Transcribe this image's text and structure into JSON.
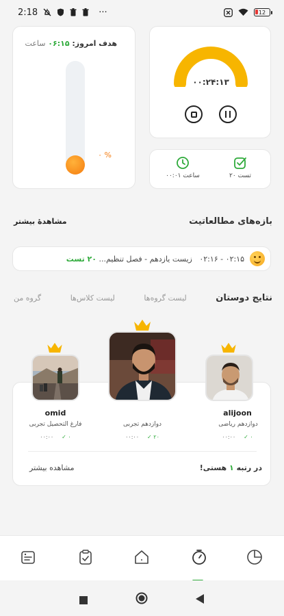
{
  "status_bar": {
    "time": "2:18",
    "more": "···",
    "battery": "12",
    "icons": [
      "mute-icon",
      "shield-icon",
      "trash-icon",
      "trash-icon",
      "dnd-icon",
      "wifi-icon",
      "battery-icon"
    ]
  },
  "goal": {
    "title": "هدف امروز:",
    "time": "۰۶:۱۵",
    "unit": "ساعت",
    "percent_label": "% ۰",
    "progress": 0
  },
  "timer": {
    "display": "۰۰:۲۴:۱۳",
    "gauge_fraction": 0.62,
    "gauge_color": "#f7b500"
  },
  "stats": {
    "tests": "۲۰ تست",
    "hours": "۰۰:۰۱ ساعت"
  },
  "sessions": {
    "title": "بازه‌های مطالعاتیت",
    "see_more": "مشاهدهٔ بیشتر",
    "entry_time": "۰۲:۱۵ - ۰۲:۱۶",
    "entry_subject": "زیست یازدهم - فصل تنظیم...",
    "entry_tests": "۲۰ تست"
  },
  "tabs": [
    "نتایج دوستان",
    "لیست گروه‌ها",
    "لیست کلاس‌ها",
    "گروه من"
  ],
  "friends": {
    "people": [
      {
        "name": "alijoon",
        "grade": "دوازدهم ریاضی",
        "tests": "۰",
        "time": "۰۰:۰۰"
      },
      {
        "name": "",
        "grade": "دوازدهم تجربی",
        "tests": "۲۰",
        "time": "۰۰:۰۰"
      },
      {
        "name": "omid",
        "grade": "فارغ التحصیل تجربی",
        "tests": "۰",
        "time": "۰۰:۰۰"
      }
    ],
    "rank_prefix": "در رتبه",
    "rank_num": "۱",
    "rank_suffix": "هستی!",
    "see_more": "مشاهده بیشتر"
  },
  "bottom_nav": [
    "report-icon",
    "timer-icon",
    "home-icon",
    "clipboard-icon",
    "notes-icon"
  ],
  "colors": {
    "accent": "#2eaa3a",
    "orange": "#f57c10",
    "gold": "#f7b500"
  }
}
